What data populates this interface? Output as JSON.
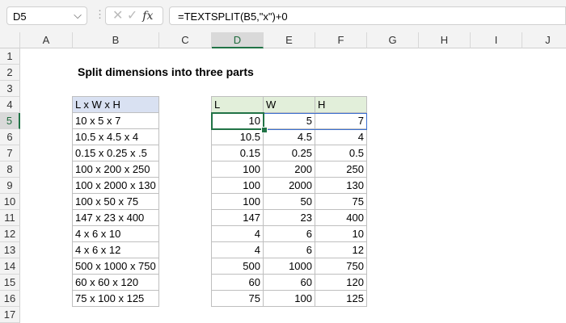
{
  "name_box": "D5",
  "formula": "=TEXTSPLIT(B5,\"x\")+0",
  "columns": [
    "A",
    "B",
    "C",
    "D",
    "E",
    "F",
    "G",
    "H",
    "I",
    "J"
  ],
  "rows": [
    "1",
    "2",
    "3",
    "4",
    "5",
    "6",
    "7",
    "8",
    "9",
    "10",
    "11",
    "12",
    "13",
    "14",
    "15",
    "16",
    "17"
  ],
  "title": "Split dimensions into three parts",
  "input_header": "L x W x H",
  "inputs": [
    "10 x 5 x 7",
    "10.5 x 4.5 x 4",
    "0.15 x 0.25 x .5",
    "100 x 200 x 250",
    "100 x 2000 x 130",
    "100 x 50 x 75",
    "147 x 23 x 400",
    "4 x 6 x 10",
    "4 x 6 x 12",
    "500 x 1000 x 750",
    "60 x 60 x 120",
    "75 x 100 x 125"
  ],
  "out_headers": [
    "L",
    "W",
    "H"
  ],
  "outputs": [
    [
      "10",
      "5",
      "7"
    ],
    [
      "10.5",
      "4.5",
      "4"
    ],
    [
      "0.15",
      "0.25",
      "0.5"
    ],
    [
      "100",
      "200",
      "250"
    ],
    [
      "100",
      "2000",
      "130"
    ],
    [
      "100",
      "50",
      "75"
    ],
    [
      "147",
      "23",
      "400"
    ],
    [
      "4",
      "6",
      "10"
    ],
    [
      "4",
      "6",
      "12"
    ],
    [
      "500",
      "1000",
      "750"
    ],
    [
      "60",
      "60",
      "120"
    ],
    [
      "75",
      "100",
      "125"
    ]
  ]
}
